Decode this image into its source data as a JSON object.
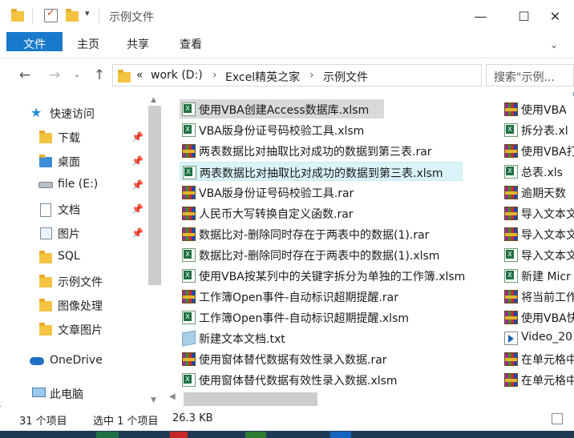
{
  "window": {
    "title": "示例文件",
    "minimize_glyph": "—",
    "maximize_glyph": "☐",
    "close_glyph": "✕"
  },
  "ribbon": {
    "tabs": [
      {
        "label": "文件"
      },
      {
        "label": "主页"
      },
      {
        "label": "共享"
      },
      {
        "label": "查看"
      }
    ]
  },
  "address": {
    "overflow": "«",
    "crumbs": [
      "work (D:)",
      "Excel精英之家",
      "示例文件"
    ],
    "separator": "›",
    "search_placeholder": "搜索\"示例..."
  },
  "nav_pane": {
    "items": [
      {
        "label": "快速访问",
        "icon": "star-icon"
      },
      {
        "label": "下载",
        "icon": "download-folder-icon",
        "pinned": true
      },
      {
        "label": "桌面",
        "icon": "desktop-folder-icon",
        "pinned": true
      },
      {
        "label": "file (E:)",
        "icon": "drive-icon",
        "pinned": true
      },
      {
        "label": "文档",
        "icon": "documents-folder-icon",
        "pinned": true
      },
      {
        "label": "图片",
        "icon": "pictures-folder-icon",
        "pinned": true
      },
      {
        "label": "SQL",
        "icon": "folder-icon"
      },
      {
        "label": "示例文件",
        "icon": "folder-icon"
      },
      {
        "label": "图像处理",
        "icon": "folder-icon"
      },
      {
        "label": "文章图片",
        "icon": "folder-icon"
      },
      {
        "label": "OneDrive",
        "icon": "cloud-icon"
      },
      {
        "label": "此电脑",
        "icon": "computer-icon"
      }
    ],
    "pin_glyph": "📌"
  },
  "files": {
    "column1": [
      {
        "name": "使用VBA创建Access数据库.xlsm",
        "type": "xlsm"
      },
      {
        "name": "VBA版身份证号码校验工具.xlsm",
        "type": "xlsm"
      },
      {
        "name": "两表数据比对抽取比对成功的数据到第三表.rar",
        "type": "rar"
      },
      {
        "name": "两表数据比对抽取比对成功的数据到第三表.xlsm",
        "type": "xlsm"
      },
      {
        "name": "VBA版身份证号码校验工具.rar",
        "type": "rar"
      },
      {
        "name": "人民币大写转换自定义函数.rar",
        "type": "rar"
      },
      {
        "name": "数据比对-删除同时存在于两表中的数据(1).rar",
        "type": "rar"
      },
      {
        "name": "数据比对-删除同时存在于两表中的数据(1).xlsm",
        "type": "xlsm"
      },
      {
        "name": "使用VBA按某列中的关键字拆分为单独的工作簿.xlsm",
        "type": "xlsm"
      },
      {
        "name": "工作簿Open事件-自动标识超期提醒.rar",
        "type": "rar"
      },
      {
        "name": "工作簿Open事件-自动标识超期提醒.xlsm",
        "type": "xlsm"
      },
      {
        "name": "新建文本文档.txt",
        "type": "txt"
      },
      {
        "name": "使用窗体替代数据有效性录入数据.rar",
        "type": "rar"
      },
      {
        "name": "使用窗体替代数据有效性录入数据.xlsm",
        "type": "xlsm"
      }
    ],
    "column2": [
      {
        "name": "使用VBA",
        "type": "rar"
      },
      {
        "name": "拆分表.xl",
        "type": "xlsm"
      },
      {
        "name": "使用VBA打",
        "type": "rar"
      },
      {
        "name": "总表.xls",
        "type": "xlsm"
      },
      {
        "name": "逾期天数",
        "type": "rar"
      },
      {
        "name": "导入文本文",
        "type": "rar"
      },
      {
        "name": "导入文本文",
        "type": "rar"
      },
      {
        "name": "导入文本文",
        "type": "xlsm"
      },
      {
        "name": "新建 Micr",
        "type": "xlsm"
      },
      {
        "name": "将当前工作",
        "type": "rar"
      },
      {
        "name": "使用VBA快",
        "type": "rar"
      },
      {
        "name": "Video_20",
        "type": "mp4"
      },
      {
        "name": "在单元格中",
        "type": "rar"
      },
      {
        "name": "在单元格中",
        "type": "rar"
      }
    ]
  },
  "status": {
    "count": "31 个项目",
    "selection": "选中 1 个项目",
    "size": "26.3 KB"
  }
}
